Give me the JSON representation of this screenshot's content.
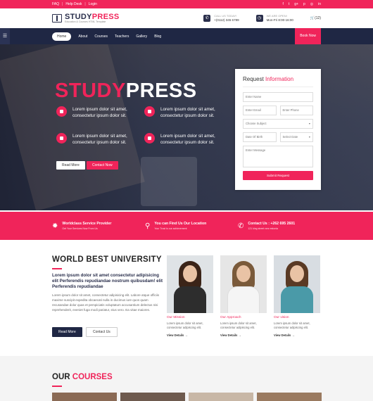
{
  "topbar": {
    "faq": "FAQ",
    "help": "Help Desk",
    "login": "Login",
    "social_icons": [
      "facebook-icon",
      "twitter-icon",
      "google-plus-icon",
      "pinterest-icon",
      "dribbble-icon",
      "linkedin-icon"
    ]
  },
  "header": {
    "logo_name_a": "STUDY",
    "logo_name_b": "PRESS",
    "logo_tag": "Education & Courses HTML Template",
    "call_label": "CALL US TODAY!",
    "call_value": "+(0112) 345 6789",
    "open_label": "WE ARE OPEN!",
    "open_value": "Mon-Fri 8:00-16:00",
    "cart": "(12)"
  },
  "nav": {
    "items": [
      "Home",
      "About",
      "Courses",
      "Teachers",
      "Gallery",
      "Blog"
    ],
    "book": "Book Now"
  },
  "hero": {
    "title_a": "STUDY",
    "title_b": "PRESS",
    "features": [
      "Lorem ipsum dolor sit amet, consectetur ipsum dolor sit.",
      "Lorem ipsum dolor sit amet, consectetur ipsum dolor sit.",
      "Lorem ipsum dolor sit amet, consectetur ipsum dolor sit.",
      "Lorem ipsum dolor sit amet, consectetur ipsum dolor sit."
    ],
    "read_more": "Read More",
    "contact_now": "Contact Now"
  },
  "form": {
    "title_a": "Request",
    "title_b": "Information",
    "name": "Enter Name",
    "email": "Enter Email",
    "phone": "Enter Phone",
    "subject": "Choose Subject",
    "dob": "Date Of Birth",
    "date": "Select Date",
    "message": "Enter Message",
    "submit": "Submit Request"
  },
  "strip": [
    {
      "title": "Worldclass Service Provider",
      "sub": "Get Your Services Now From Us"
    },
    {
      "title": "You can Find Us Our Location",
      "sub": "Your Trust is our achievement"
    },
    {
      "title": "Contact Us : +262 695 2601",
      "sub": "121 king street new estonia"
    }
  ],
  "about": {
    "heading": "WORLD BEST UNIVERSITY",
    "lead": "Lorem ipsum dolor sit amet consectetur adipisicing elit Perferendis repudiandae nostrum quibusdam! elit Perferendis repudiandae",
    "body": "Lorem ipsum dolor sit amet, consectetur adipisicing elit. Labore atque officiis maxime suscipit expedita obcaecati nulla in ducimus iure quos quam recusandae dolor quas et perspiciatis voluptatum accusantium delectus nisi reprehenderit, eveniet fuga modi pariatur, eius vero. Ea vitae maiores.",
    "read_more": "Read More",
    "contact_us": "Contact Us",
    "cards": [
      {
        "title": "Our Mission",
        "text": "Lorem ipsum dolor sit amet, consectetur adipiscing elit.",
        "link": "View Details →"
      },
      {
        "title": "Our Approach",
        "text": "Lorem ipsum dolor sit amet, consectetur adipiscing elit.",
        "link": "View Details →"
      },
      {
        "title": "Our vision",
        "text": "Lorem ipsum dolor sit amet, consectetur adipiscing elit.",
        "link": "View Details →"
      }
    ]
  },
  "courses": {
    "heading_a": "OUR",
    "heading_b": "COURSES"
  },
  "colors": {
    "accent": "#f0245a",
    "navy": "#1f2744"
  }
}
